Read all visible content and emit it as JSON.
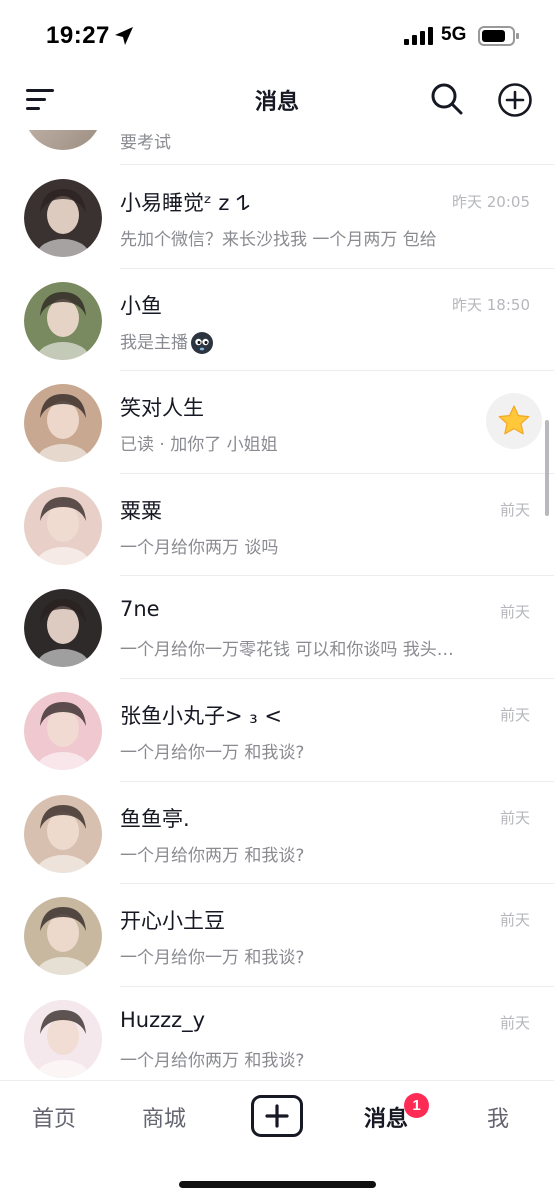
{
  "status_bar": {
    "time": "19:27",
    "location_icon": "location-arrow-icon",
    "signal_icon": "cellular-signal-icon",
    "network": "5G",
    "battery_icon": "battery-icon"
  },
  "header": {
    "title": "消息",
    "menu_icon": "menu-icon",
    "search_icon": "search-icon",
    "add_icon": "add-circle-icon"
  },
  "partial_row": {
    "preview": "要考试"
  },
  "messages": [
    {
      "name": "小易睡觉ᶻ z 𐰁",
      "preview": "先加个微信？来长沙找我 一个月两万 包给",
      "time": "昨天 20:05",
      "avatar_color": "#3a3230"
    },
    {
      "name": "小鱼",
      "preview": "我是主播",
      "preview_emoji": "ghost-emoji-icon",
      "time": "昨天 18:50",
      "avatar_color": "#7a8a60"
    },
    {
      "name": "笑对人生",
      "preview": "已读 · 加你了 小姐姐",
      "time": "",
      "action_icon": "star-icon",
      "avatar_color": "#c8a890"
    },
    {
      "name": "粟粟",
      "preview": "一个月给你两万 谈吗",
      "time": "前天",
      "avatar_color": "#e8d0c8"
    },
    {
      "name": "7ne",
      "preview": "一个月给你一万零花钱 可以和你谈吗 我头…",
      "time": "前天",
      "avatar_color": "#2e2a2a"
    },
    {
      "name": "张鱼小丸子> ₃ <",
      "preview": "一个月给你一万 和我谈?",
      "time": "前天",
      "avatar_color": "#f0c8d0"
    },
    {
      "name": "鱼鱼亭.",
      "preview": "一个月给你两万 和我谈?",
      "time": "前天",
      "avatar_color": "#d8c0b0"
    },
    {
      "name": "开心小土豆",
      "preview": "一个月给你一万 和我谈?",
      "time": "前天",
      "avatar_color": "#c8b8a0"
    },
    {
      "name": "Huzzz_y",
      "preview": "一个月给你两万 和我谈?",
      "time": "前天",
      "avatar_color": "#f5e8ec"
    }
  ],
  "tab_bar": {
    "home": "首页",
    "mall": "商城",
    "create_icon": "plus-icon",
    "messages": "消息",
    "messages_badge": "1",
    "me": "我"
  }
}
